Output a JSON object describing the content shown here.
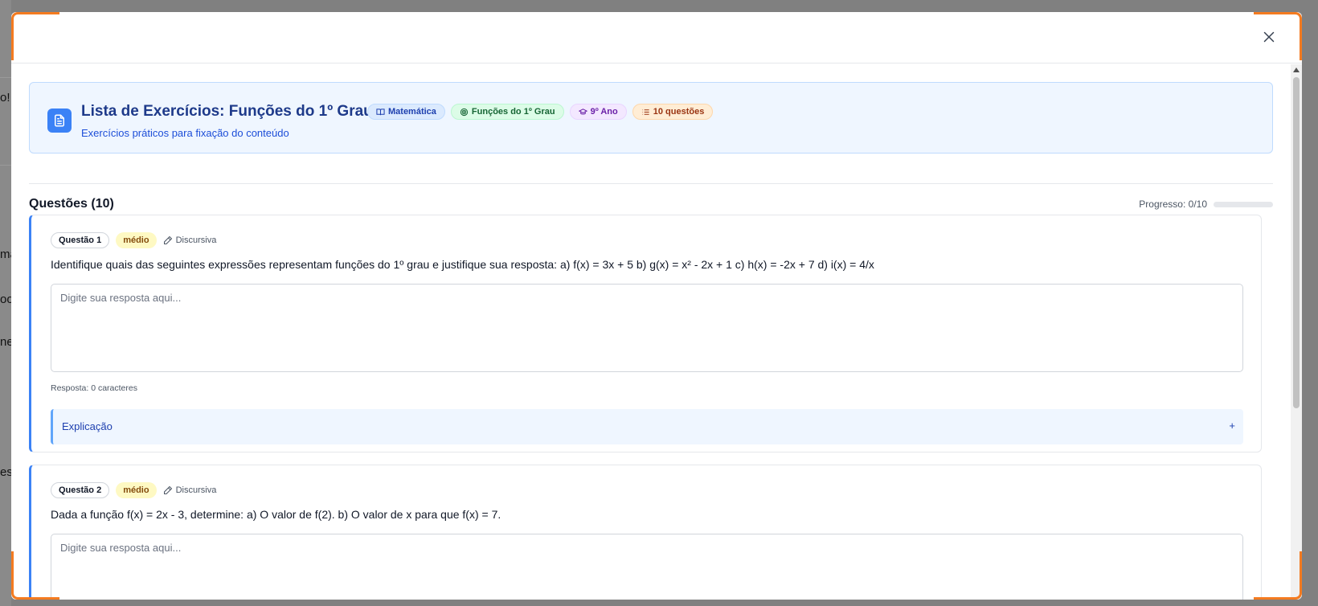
{
  "background": {
    "fragments": [
      "o!",
      "ma",
      "oo",
      "ne",
      "es"
    ]
  },
  "modal": {
    "close_icon": "close-icon"
  },
  "list": {
    "title": "Lista de Exercícios: Funções do 1º Grau",
    "subtitle": "Exercícios práticos para fixação do conteúdo",
    "icon": "document-icon",
    "badges": [
      {
        "label": "Matemática",
        "icon": "book-icon",
        "color": "#1e40af"
      },
      {
        "label": "Funções do 1º Grau",
        "icon": "target-icon",
        "color": "#166534"
      },
      {
        "label": "9º Ano",
        "icon": "graduation-cap-icon",
        "color": "#6b21a8"
      },
      {
        "label": "10 questões",
        "icon": "list-icon",
        "color": "#9a3412"
      }
    ]
  },
  "questions_section": {
    "title": "Questões (10)",
    "progress_label": "Progresso: 0/10",
    "progress_value": 0
  },
  "questions": [
    {
      "number_label": "Questão 1",
      "difficulty": "médio",
      "type_label": "Discursiva",
      "text": "Identifique quais das seguintes expressões representam funções do 1º grau e justifique sua resposta: a) f(x) = 3x + 5 b) g(x) = x² - 2x + 1 c) h(x) = -2x + 7 d) i(x) = 4/x",
      "answer_placeholder": "Digite sua resposta aqui...",
      "answer_value": "",
      "char_count_label": "Resposta: 0 caracteres",
      "explanation_label": "Explicação",
      "explanation_toggle": "+"
    },
    {
      "number_label": "Questão 2",
      "difficulty": "médio",
      "type_label": "Discursiva",
      "text": "Dada a função f(x) = 2x - 3, determine: a) O valor de f(2). b) O valor de x para que f(x) = 7.",
      "answer_placeholder": "Digite sua resposta aqui...",
      "answer_value": ""
    }
  ],
  "colors": {
    "accent": "#3b82f6",
    "frame_accent": "#f47b20",
    "title": "#1e3a8a"
  }
}
